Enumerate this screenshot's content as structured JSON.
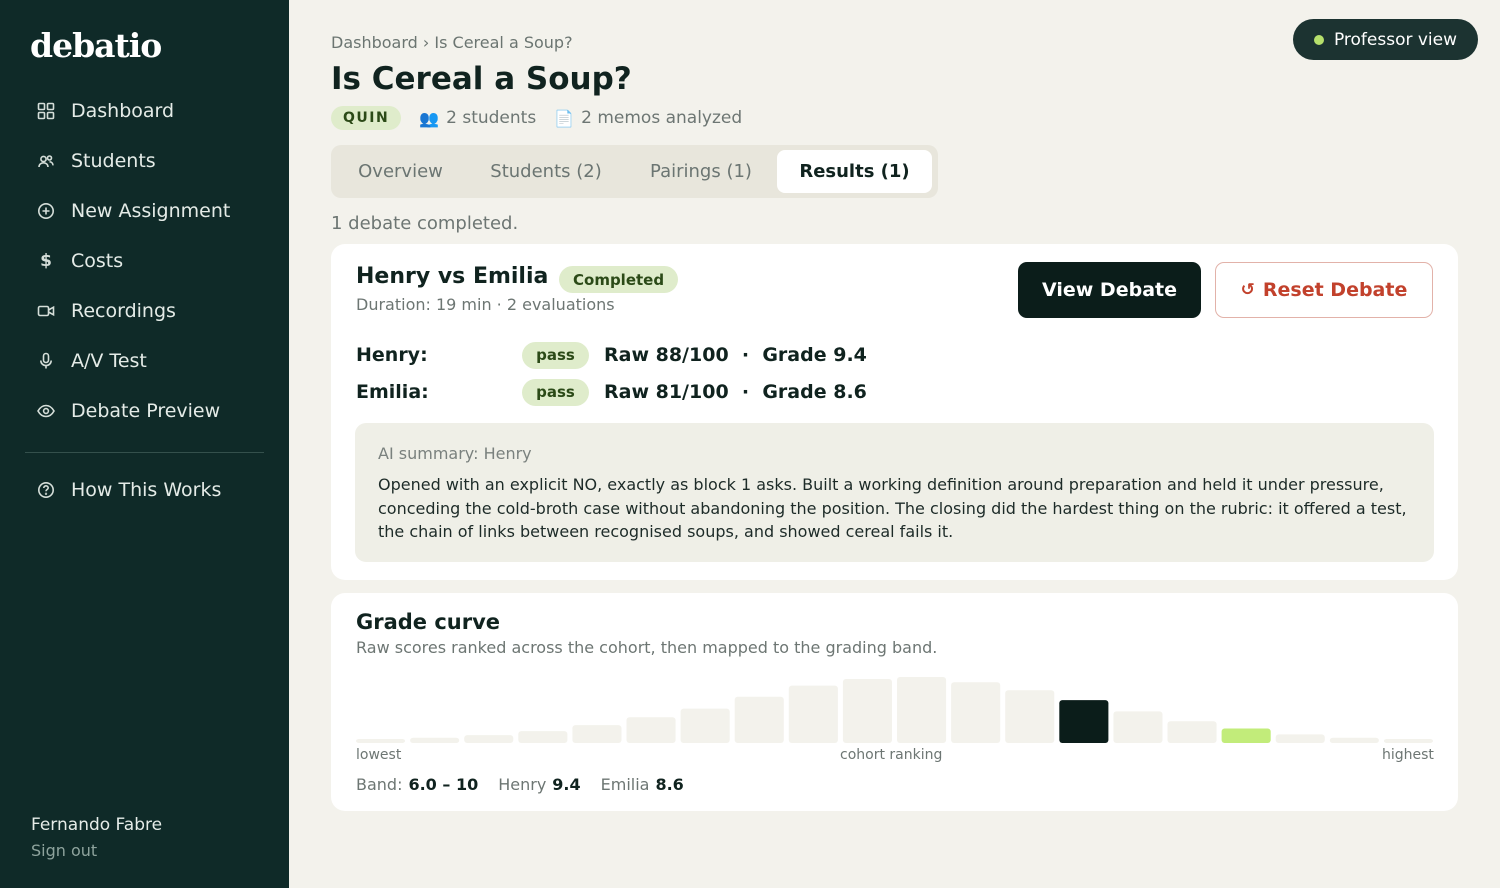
{
  "app": {
    "logo": "debatio",
    "user_name": "Fernando Fabre",
    "sign_out": "Sign out",
    "professor_view": "Professor view"
  },
  "sidebar": {
    "items": [
      {
        "label": "Dashboard",
        "icon": "grid-icon"
      },
      {
        "label": "Students",
        "icon": "users-icon"
      },
      {
        "label": "New Assignment",
        "icon": "plus-circle-icon"
      },
      {
        "label": "Costs",
        "icon": "dollar-icon"
      },
      {
        "label": "Recordings",
        "icon": "video-icon"
      },
      {
        "label": "A/V Test",
        "icon": "microphone-icon"
      },
      {
        "label": "Debate Preview",
        "icon": "eye-icon"
      }
    ],
    "help": {
      "label": "How This Works",
      "icon": "help-circle-icon"
    }
  },
  "header": {
    "breadcrumb": "Dashboard › Is Cereal a Soup?",
    "title": "Is Cereal a Soup?",
    "tag": "QUIN",
    "students": "2 students",
    "memos": "2 memos analyzed"
  },
  "tabs": [
    {
      "label": "Overview"
    },
    {
      "label": "Students (2)"
    },
    {
      "label": "Pairings (1)"
    },
    {
      "label": "Results (1)"
    }
  ],
  "results": {
    "summary": "1 debate completed.",
    "debate": {
      "title": "Henry vs Emilia",
      "status": "Completed",
      "duration": "Duration: 19 min · 2 evaluations",
      "view_label": "View Debate",
      "reset_label": "Reset Debate",
      "scores": [
        {
          "name": "Henry:",
          "result": "pass",
          "text": "Raw 88/100  ·  Grade 9.4"
        },
        {
          "name": "Emilia:",
          "result": "pass",
          "text": "Raw 81/100  ·  Grade 8.6"
        }
      ],
      "ai_summary_title": "AI summary: Henry",
      "ai_summary_text": "Opened with an explicit NO, exactly as block 1 asks. Built a working definition around preparation and held it under pressure, conceding the cold-broth case without abandoning the position. The closing did the hardest thing on the rubric: it offered a test, the chain of links between recognised soups, and showed cereal fails it."
    }
  },
  "grade_curve": {
    "title": "Grade curve",
    "subtitle": "Raw scores ranked across the cohort, then mapped to the grading band.",
    "low_label": "lowest",
    "mid_label": "cohort ranking",
    "high_label": "highest",
    "band_label": "Band:",
    "band_value": "6.0 – 10",
    "henry_label": "Henry",
    "henry_value": "9.4",
    "emilia_label": "Emilia",
    "emilia_value": "8.6"
  },
  "chart_data": {
    "type": "bar",
    "xlabel": "cohort ranking",
    "values": [
      0.06,
      0.08,
      0.12,
      0.18,
      0.27,
      0.39,
      0.52,
      0.7,
      0.87,
      0.97,
      1.0,
      0.92,
      0.8,
      0.65,
      0.48,
      0.33,
      0.22,
      0.13,
      0.08,
      0.06
    ],
    "highlight": [
      {
        "index": 13,
        "name": "Henry",
        "color": "#0b1d1a"
      },
      {
        "index": 16,
        "name": "Emilia",
        "color": "#c2ec7a"
      }
    ],
    "bar_color": "#f3f2ec"
  }
}
